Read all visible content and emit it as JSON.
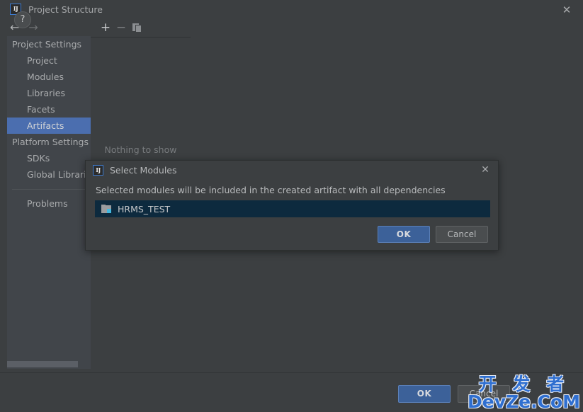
{
  "window": {
    "title": "Project Structure",
    "app_icon": "IJ",
    "close_icon": "✕"
  },
  "nav": {
    "back_icon": "←",
    "forward_icon": "→"
  },
  "sidebar": {
    "items": [
      {
        "label": "Project Settings",
        "type": "group",
        "selected": false
      },
      {
        "label": "Project",
        "type": "child",
        "selected": false
      },
      {
        "label": "Modules",
        "type": "child",
        "selected": false
      },
      {
        "label": "Libraries",
        "type": "child",
        "selected": false
      },
      {
        "label": "Facets",
        "type": "child",
        "selected": false
      },
      {
        "label": "Artifacts",
        "type": "child",
        "selected": true
      },
      {
        "label": "Platform Settings",
        "type": "group",
        "selected": false
      },
      {
        "label": "SDKs",
        "type": "child",
        "selected": false
      },
      {
        "label": "Global Librari",
        "type": "child",
        "selected": false
      }
    ],
    "after_divider": [
      {
        "label": "Problems",
        "type": "child",
        "selected": false
      }
    ]
  },
  "toolbar": {
    "add_icon": "+",
    "remove_icon": "−",
    "copy_icon": "copy-icon"
  },
  "list_panel": {
    "empty_text": "Nothing to show"
  },
  "footer": {
    "help_label": "?",
    "ok_label": "OK",
    "cancel_label": "Cancel"
  },
  "dialog": {
    "app_icon": "IJ",
    "title": "Select Modules",
    "close_icon": "✕",
    "description": "Selected modules will be included in the created artifact with all dependencies",
    "modules": [
      {
        "name": "HRMS_TEST",
        "icon": "module-icon",
        "selected": true
      }
    ],
    "ok_label": "OK",
    "cancel_label": "Cancel"
  },
  "watermark": {
    "line1": "开 发 者",
    "line2": "DevZe.CoM"
  },
  "colors": {
    "background": "#3c3f41",
    "sidebar_background": "#41454a",
    "selection_blue": "#4b6eaf",
    "list_selection": "#0d2a3e",
    "primary_button": "#3c6199",
    "accent_cyan": "#42b8e0",
    "watermark_blue": "#2f6fd0"
  }
}
